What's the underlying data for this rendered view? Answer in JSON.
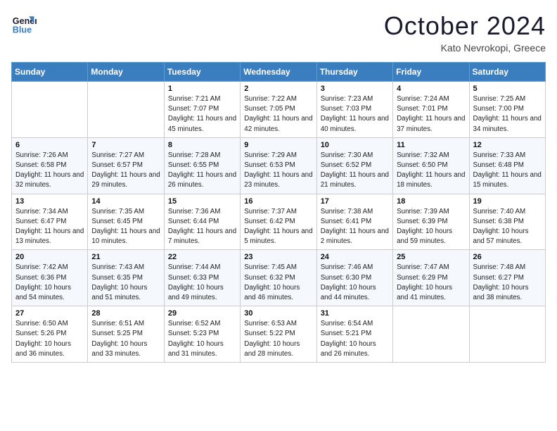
{
  "header": {
    "logo_line1": "General",
    "logo_line2": "Blue",
    "month": "October 2024",
    "location": "Kato Nevrokopi, Greece"
  },
  "weekdays": [
    "Sunday",
    "Monday",
    "Tuesday",
    "Wednesday",
    "Thursday",
    "Friday",
    "Saturday"
  ],
  "weeks": [
    [
      {
        "day": "",
        "info": ""
      },
      {
        "day": "",
        "info": ""
      },
      {
        "day": "1",
        "info": "Sunrise: 7:21 AM\nSunset: 7:07 PM\nDaylight: 11 hours and 45 minutes."
      },
      {
        "day": "2",
        "info": "Sunrise: 7:22 AM\nSunset: 7:05 PM\nDaylight: 11 hours and 42 minutes."
      },
      {
        "day": "3",
        "info": "Sunrise: 7:23 AM\nSunset: 7:03 PM\nDaylight: 11 hours and 40 minutes."
      },
      {
        "day": "4",
        "info": "Sunrise: 7:24 AM\nSunset: 7:01 PM\nDaylight: 11 hours and 37 minutes."
      },
      {
        "day": "5",
        "info": "Sunrise: 7:25 AM\nSunset: 7:00 PM\nDaylight: 11 hours and 34 minutes."
      }
    ],
    [
      {
        "day": "6",
        "info": "Sunrise: 7:26 AM\nSunset: 6:58 PM\nDaylight: 11 hours and 32 minutes."
      },
      {
        "day": "7",
        "info": "Sunrise: 7:27 AM\nSunset: 6:57 PM\nDaylight: 11 hours and 29 minutes."
      },
      {
        "day": "8",
        "info": "Sunrise: 7:28 AM\nSunset: 6:55 PM\nDaylight: 11 hours and 26 minutes."
      },
      {
        "day": "9",
        "info": "Sunrise: 7:29 AM\nSunset: 6:53 PM\nDaylight: 11 hours and 23 minutes."
      },
      {
        "day": "10",
        "info": "Sunrise: 7:30 AM\nSunset: 6:52 PM\nDaylight: 11 hours and 21 minutes."
      },
      {
        "day": "11",
        "info": "Sunrise: 7:32 AM\nSunset: 6:50 PM\nDaylight: 11 hours and 18 minutes."
      },
      {
        "day": "12",
        "info": "Sunrise: 7:33 AM\nSunset: 6:48 PM\nDaylight: 11 hours and 15 minutes."
      }
    ],
    [
      {
        "day": "13",
        "info": "Sunrise: 7:34 AM\nSunset: 6:47 PM\nDaylight: 11 hours and 13 minutes."
      },
      {
        "day": "14",
        "info": "Sunrise: 7:35 AM\nSunset: 6:45 PM\nDaylight: 11 hours and 10 minutes."
      },
      {
        "day": "15",
        "info": "Sunrise: 7:36 AM\nSunset: 6:44 PM\nDaylight: 11 hours and 7 minutes."
      },
      {
        "day": "16",
        "info": "Sunrise: 7:37 AM\nSunset: 6:42 PM\nDaylight: 11 hours and 5 minutes."
      },
      {
        "day": "17",
        "info": "Sunrise: 7:38 AM\nSunset: 6:41 PM\nDaylight: 11 hours and 2 minutes."
      },
      {
        "day": "18",
        "info": "Sunrise: 7:39 AM\nSunset: 6:39 PM\nDaylight: 10 hours and 59 minutes."
      },
      {
        "day": "19",
        "info": "Sunrise: 7:40 AM\nSunset: 6:38 PM\nDaylight: 10 hours and 57 minutes."
      }
    ],
    [
      {
        "day": "20",
        "info": "Sunrise: 7:42 AM\nSunset: 6:36 PM\nDaylight: 10 hours and 54 minutes."
      },
      {
        "day": "21",
        "info": "Sunrise: 7:43 AM\nSunset: 6:35 PM\nDaylight: 10 hours and 51 minutes."
      },
      {
        "day": "22",
        "info": "Sunrise: 7:44 AM\nSunset: 6:33 PM\nDaylight: 10 hours and 49 minutes."
      },
      {
        "day": "23",
        "info": "Sunrise: 7:45 AM\nSunset: 6:32 PM\nDaylight: 10 hours and 46 minutes."
      },
      {
        "day": "24",
        "info": "Sunrise: 7:46 AM\nSunset: 6:30 PM\nDaylight: 10 hours and 44 minutes."
      },
      {
        "day": "25",
        "info": "Sunrise: 7:47 AM\nSunset: 6:29 PM\nDaylight: 10 hours and 41 minutes."
      },
      {
        "day": "26",
        "info": "Sunrise: 7:48 AM\nSunset: 6:27 PM\nDaylight: 10 hours and 38 minutes."
      }
    ],
    [
      {
        "day": "27",
        "info": "Sunrise: 6:50 AM\nSunset: 5:26 PM\nDaylight: 10 hours and 36 minutes."
      },
      {
        "day": "28",
        "info": "Sunrise: 6:51 AM\nSunset: 5:25 PM\nDaylight: 10 hours and 33 minutes."
      },
      {
        "day": "29",
        "info": "Sunrise: 6:52 AM\nSunset: 5:23 PM\nDaylight: 10 hours and 31 minutes."
      },
      {
        "day": "30",
        "info": "Sunrise: 6:53 AM\nSunset: 5:22 PM\nDaylight: 10 hours and 28 minutes."
      },
      {
        "day": "31",
        "info": "Sunrise: 6:54 AM\nSunset: 5:21 PM\nDaylight: 10 hours and 26 minutes."
      },
      {
        "day": "",
        "info": ""
      },
      {
        "day": "",
        "info": ""
      }
    ]
  ]
}
